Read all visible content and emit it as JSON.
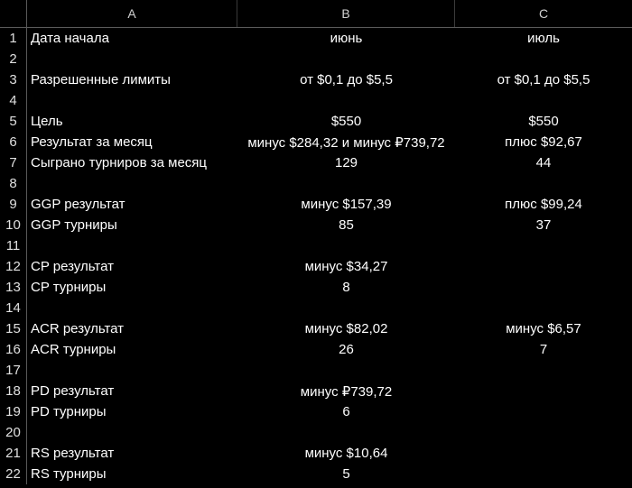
{
  "columns": [
    "A",
    "B",
    "C"
  ],
  "rows": [
    {
      "n": "1",
      "a": "Дата начала",
      "b": "июнь",
      "c": "июль"
    },
    {
      "n": "2",
      "a": "",
      "b": "",
      "c": ""
    },
    {
      "n": "3",
      "a": "Разрешенные лимиты",
      "b": "от $0,1 до $5,5",
      "c": "от $0,1 до $5,5"
    },
    {
      "n": "4",
      "a": "",
      "b": "",
      "c": ""
    },
    {
      "n": "5",
      "a": "Цель",
      "b": "$550",
      "c": "$550"
    },
    {
      "n": "6",
      "a": "Результат за месяц",
      "b": "минус $284,32 и минус ₽739,72",
      "c": "плюс $92,67"
    },
    {
      "n": "7",
      "a": "Сыграно турниров за месяц",
      "b": "129",
      "c": "44"
    },
    {
      "n": "8",
      "a": "",
      "b": "",
      "c": ""
    },
    {
      "n": "9",
      "a": "GGP результат",
      "b": "минус $157,39",
      "c": "плюс $99,24"
    },
    {
      "n": "10",
      "a": "GGP турниры",
      "b": "85",
      "c": "37"
    },
    {
      "n": "11",
      "a": "",
      "b": "",
      "c": ""
    },
    {
      "n": "12",
      "a": "CP результат",
      "b": "минус $34,27",
      "c": ""
    },
    {
      "n": "13",
      "a": "CP турниры",
      "b": "8",
      "c": ""
    },
    {
      "n": "14",
      "a": "",
      "b": "",
      "c": ""
    },
    {
      "n": "15",
      "a": "ACR результат",
      "b": "минус $82,02",
      "c": "минус $6,57"
    },
    {
      "n": "16",
      "a": "ACR турниры",
      "b": "26",
      "c": "7"
    },
    {
      "n": "17",
      "a": "",
      "b": "",
      "c": ""
    },
    {
      "n": "18",
      "a": "PD результат",
      "b": "минус ₽739,72",
      "c": ""
    },
    {
      "n": "19",
      "a": "PD турниры",
      "b": "6",
      "c": ""
    },
    {
      "n": "20",
      "a": "",
      "b": "",
      "c": ""
    },
    {
      "n": "21",
      "a": "RS результат",
      "b": "минус $10,64",
      "c": ""
    },
    {
      "n": "22",
      "a": "RS турниры",
      "b": "5",
      "c": ""
    }
  ]
}
